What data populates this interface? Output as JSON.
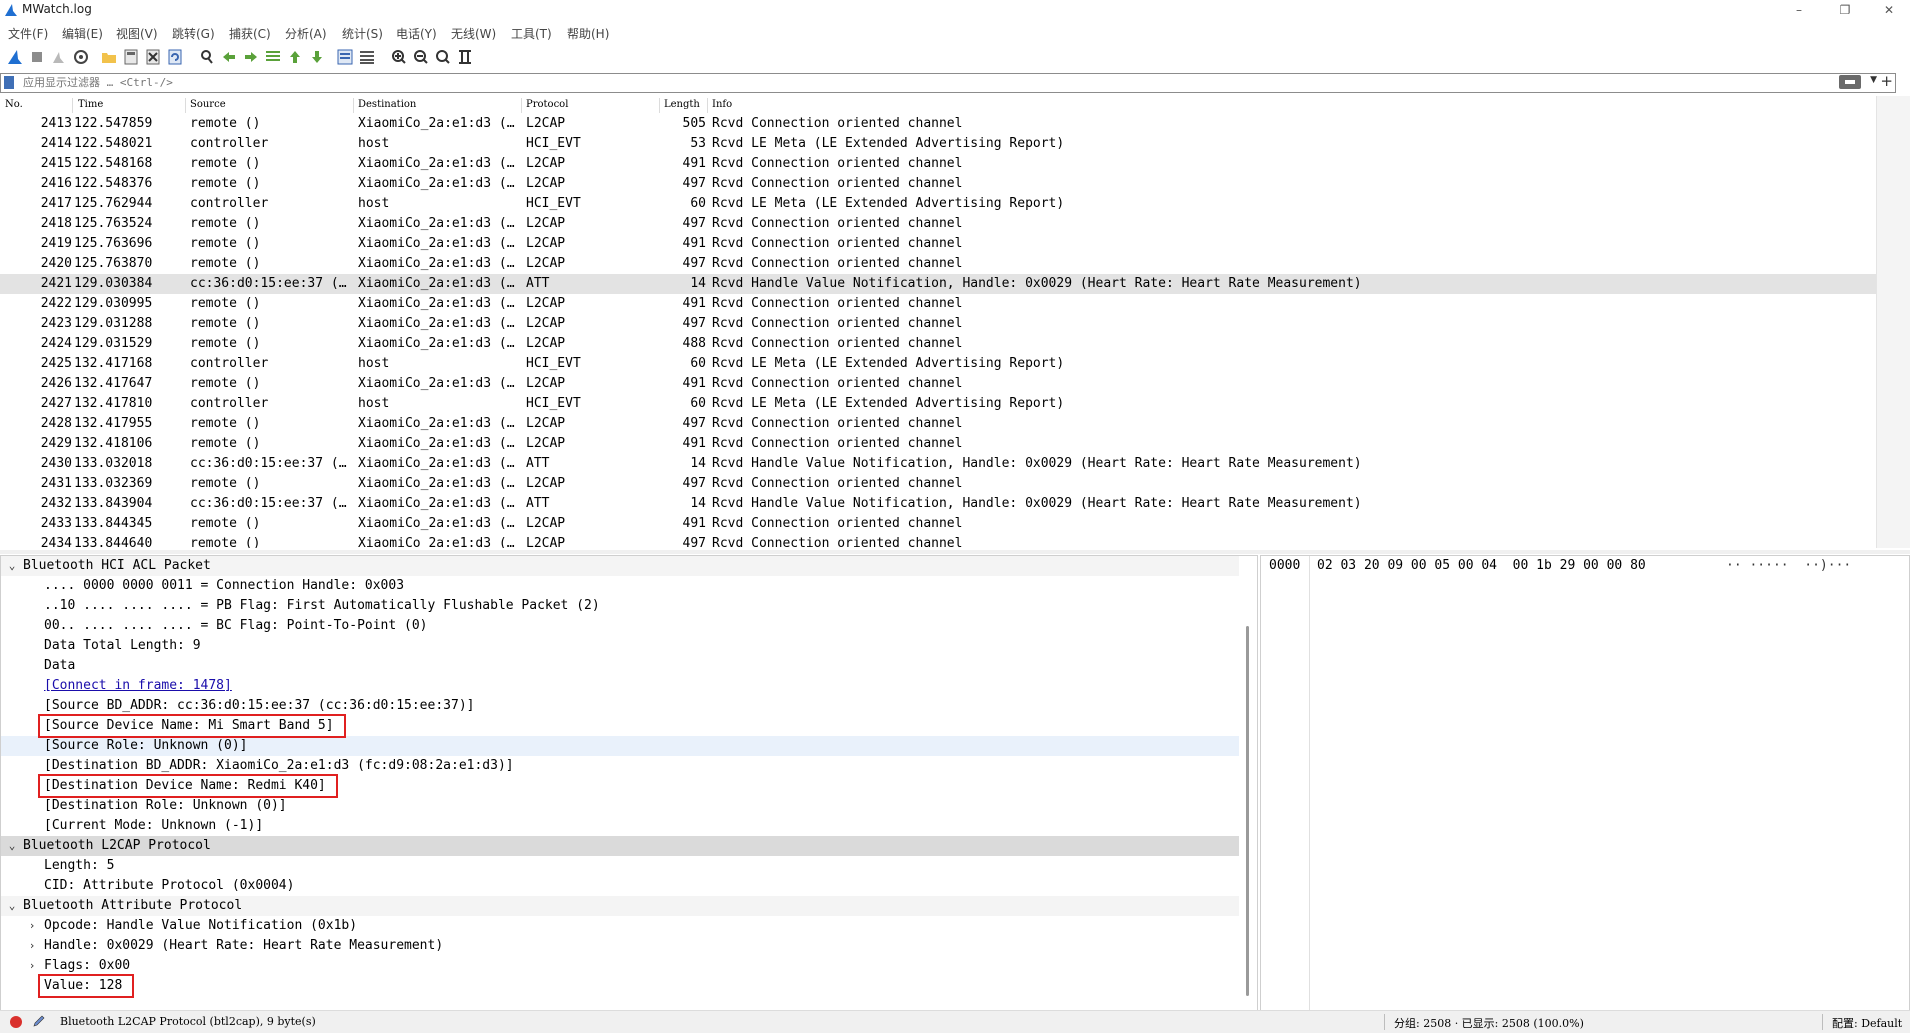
{
  "window": {
    "title": "MWatch.log",
    "minimize": "–",
    "maximize": "❐",
    "close": "✕"
  },
  "menu": [
    "文件(F)",
    "编辑(E)",
    "视图(V)",
    "跳转(G)",
    "捕获(C)",
    "分析(A)",
    "统计(S)",
    "电话(Y)",
    "无线(W)",
    "工具(T)",
    "帮助(H)"
  ],
  "toolbar_icons": [
    "shark-fin-start-icon",
    "stop-icon",
    "restart-icon",
    "capture-options-icon",
    "open-folder-icon",
    "save-file-icon",
    "close-file-icon",
    "reload-icon",
    "find-packet-icon",
    "go-back-icon",
    "go-forward-icon",
    "go-to-packet-icon",
    "first-packet-icon",
    "last-packet-icon",
    "autoscroll-icon",
    "colorize-icon",
    "zoom-in-icon",
    "zoom-out-icon",
    "zoom-normal-icon",
    "resize-columns-icon"
  ],
  "filter": {
    "placeholder": "应用显示过滤器 … <Ctrl-/>",
    "value": ""
  },
  "packet_list": {
    "columns": [
      "No.",
      "Time",
      "Source",
      "Destination",
      "Protocol",
      "Length",
      "Info"
    ],
    "rows": [
      {
        "no": "2413",
        "time": "122.547859",
        "src": "remote ()",
        "dst": "XiaomiCo_2a:e1:d3 (…",
        "proto": "L2CAP",
        "len": "505",
        "info": "Rcvd Connection oriented channel"
      },
      {
        "no": "2414",
        "time": "122.548021",
        "src": "controller",
        "dst": "host",
        "proto": "HCI_EVT",
        "len": "53",
        "info": "Rcvd LE Meta (LE Extended Advertising Report)"
      },
      {
        "no": "2415",
        "time": "122.548168",
        "src": "remote ()",
        "dst": "XiaomiCo_2a:e1:d3 (…",
        "proto": "L2CAP",
        "len": "491",
        "info": "Rcvd Connection oriented channel"
      },
      {
        "no": "2416",
        "time": "122.548376",
        "src": "remote ()",
        "dst": "XiaomiCo_2a:e1:d3 (…",
        "proto": "L2CAP",
        "len": "497",
        "info": "Rcvd Connection oriented channel"
      },
      {
        "no": "2417",
        "time": "125.762944",
        "src": "controller",
        "dst": "host",
        "proto": "HCI_EVT",
        "len": "60",
        "info": "Rcvd LE Meta (LE Extended Advertising Report)"
      },
      {
        "no": "2418",
        "time": "125.763524",
        "src": "remote ()",
        "dst": "XiaomiCo_2a:e1:d3 (…",
        "proto": "L2CAP",
        "len": "497",
        "info": "Rcvd Connection oriented channel"
      },
      {
        "no": "2419",
        "time": "125.763696",
        "src": "remote ()",
        "dst": "XiaomiCo_2a:e1:d3 (…",
        "proto": "L2CAP",
        "len": "491",
        "info": "Rcvd Connection oriented channel"
      },
      {
        "no": "2420",
        "time": "125.763870",
        "src": "remote ()",
        "dst": "XiaomiCo_2a:e1:d3 (…",
        "proto": "L2CAP",
        "len": "497",
        "info": "Rcvd Connection oriented channel"
      },
      {
        "no": "2421",
        "time": "129.030384",
        "src": "cc:36:d0:15:ee:37 (…",
        "dst": "XiaomiCo_2a:e1:d3 (…",
        "proto": "ATT",
        "len": "14",
        "info": "Rcvd Handle Value Notification, Handle: 0x0029 (Heart Rate: Heart Rate Measurement)",
        "selected": true
      },
      {
        "no": "2422",
        "time": "129.030995",
        "src": "remote ()",
        "dst": "XiaomiCo_2a:e1:d3 (…",
        "proto": "L2CAP",
        "len": "491",
        "info": "Rcvd Connection oriented channel"
      },
      {
        "no": "2423",
        "time": "129.031288",
        "src": "remote ()",
        "dst": "XiaomiCo_2a:e1:d3 (…",
        "proto": "L2CAP",
        "len": "497",
        "info": "Rcvd Connection oriented channel"
      },
      {
        "no": "2424",
        "time": "129.031529",
        "src": "remote ()",
        "dst": "XiaomiCo_2a:e1:d3 (…",
        "proto": "L2CAP",
        "len": "488",
        "info": "Rcvd Connection oriented channel"
      },
      {
        "no": "2425",
        "time": "132.417168",
        "src": "controller",
        "dst": "host",
        "proto": "HCI_EVT",
        "len": "60",
        "info": "Rcvd LE Meta (LE Extended Advertising Report)"
      },
      {
        "no": "2426",
        "time": "132.417647",
        "src": "remote ()",
        "dst": "XiaomiCo_2a:e1:d3 (…",
        "proto": "L2CAP",
        "len": "491",
        "info": "Rcvd Connection oriented channel"
      },
      {
        "no": "2427",
        "time": "132.417810",
        "src": "controller",
        "dst": "host",
        "proto": "HCI_EVT",
        "len": "60",
        "info": "Rcvd LE Meta (LE Extended Advertising Report)"
      },
      {
        "no": "2428",
        "time": "132.417955",
        "src": "remote ()",
        "dst": "XiaomiCo_2a:e1:d3 (…",
        "proto": "L2CAP",
        "len": "497",
        "info": "Rcvd Connection oriented channel"
      },
      {
        "no": "2429",
        "time": "132.418106",
        "src": "remote ()",
        "dst": "XiaomiCo_2a:e1:d3 (…",
        "proto": "L2CAP",
        "len": "491",
        "info": "Rcvd Connection oriented channel"
      },
      {
        "no": "2430",
        "time": "133.032018",
        "src": "cc:36:d0:15:ee:37 (…",
        "dst": "XiaomiCo_2a:e1:d3 (…",
        "proto": "ATT",
        "len": "14",
        "info": "Rcvd Handle Value Notification, Handle: 0x0029 (Heart Rate: Heart Rate Measurement)"
      },
      {
        "no": "2431",
        "time": "133.032369",
        "src": "remote ()",
        "dst": "XiaomiCo_2a:e1:d3 (…",
        "proto": "L2CAP",
        "len": "497",
        "info": "Rcvd Connection oriented channel"
      },
      {
        "no": "2432",
        "time": "133.843904",
        "src": "cc:36:d0:15:ee:37 (…",
        "dst": "XiaomiCo_2a:e1:d3 (…",
        "proto": "ATT",
        "len": "14",
        "info": "Rcvd Handle Value Notification, Handle: 0x0029 (Heart Rate: Heart Rate Measurement)"
      },
      {
        "no": "2433",
        "time": "133.844345",
        "src": "remote ()",
        "dst": "XiaomiCo_2a:e1:d3 (…",
        "proto": "L2CAP",
        "len": "491",
        "info": "Rcvd Connection oriented channel"
      },
      {
        "no": "2434",
        "time": "133.844640",
        "src": "remote ()",
        "dst": "XiaomiCo_2a:e1:d3 (…",
        "proto": "L2CAP",
        "len": "497",
        "info": "Rcvd Connection oriented channel"
      }
    ]
  },
  "details": [
    {
      "indent": 0,
      "arrow": "⌄",
      "text": "Bluetooth HCI ACL Packet",
      "style": "hdr"
    },
    {
      "indent": 2,
      "text": ".... 0000 0000 0011 = Connection Handle: 0x003"
    },
    {
      "indent": 2,
      "text": "..10 .... .... .... = PB Flag: First Automatically Flushable Packet (2)"
    },
    {
      "indent": 2,
      "text": "00.. .... .... .... = BC Flag: Point-To-Point (0)"
    },
    {
      "indent": 2,
      "text": "Data Total Length: 9"
    },
    {
      "indent": 2,
      "text": "Data"
    },
    {
      "indent": 2,
      "text": "[Connect in frame: 1478]",
      "link": true
    },
    {
      "indent": 2,
      "text": "[Source BD_ADDR: cc:36:d0:15:ee:37 (cc:36:d0:15:ee:37)]"
    },
    {
      "indent": 2,
      "text": "[Source Device Name: Mi Smart Band 5]",
      "boxed": true
    },
    {
      "indent": 2,
      "text": "[Source Role: Unknown (0)]",
      "style": "hl"
    },
    {
      "indent": 2,
      "text": "[Destination BD_ADDR: XiaomiCo_2a:e1:d3 (fc:d9:08:2a:e1:d3)]"
    },
    {
      "indent": 2,
      "text": "[Destination Device Name: Redmi K40]",
      "boxed": true
    },
    {
      "indent": 2,
      "text": "[Destination Role: Unknown (0)]"
    },
    {
      "indent": 2,
      "text": "[Current Mode: Unknown (-1)]"
    },
    {
      "indent": 0,
      "arrow": "⌄",
      "text": "Bluetooth L2CAP Protocol",
      "style": "band"
    },
    {
      "indent": 2,
      "text": "Length: 5"
    },
    {
      "indent": 2,
      "text": "CID: Attribute Protocol (0x0004)"
    },
    {
      "indent": 0,
      "arrow": "⌄",
      "text": "Bluetooth Attribute Protocol",
      "style": "hdr"
    },
    {
      "indent": 1,
      "arrow": "›",
      "text": "Opcode: Handle Value Notification (0x1b)"
    },
    {
      "indent": 1,
      "arrow": "›",
      "text": "Handle: 0x0029 (Heart Rate: Heart Rate Measurement)"
    },
    {
      "indent": 1,
      "arrow": "›",
      "text": "Flags: 0x00"
    },
    {
      "indent": 2,
      "text": "Value: 128",
      "boxed": true
    }
  ],
  "hex": {
    "offset": "0000",
    "bytes": "02 03 20 09 00 05 00 04  00 1b 29 00 00 80",
    "ascii": "·· ·····  ··)···"
  },
  "status": {
    "left": "Bluetooth L2CAP Protocol (btl2cap), 9 byte(s)",
    "stats": "分组: 2508 · 已显示: 2508 (100.0%)",
    "profile": "配置: Default"
  },
  "colors": {
    "selected_row": "#e3e3e3",
    "highlight_row": "#e9f1fb",
    "annotation_box": "#e02020",
    "link": "#1a0dab"
  }
}
